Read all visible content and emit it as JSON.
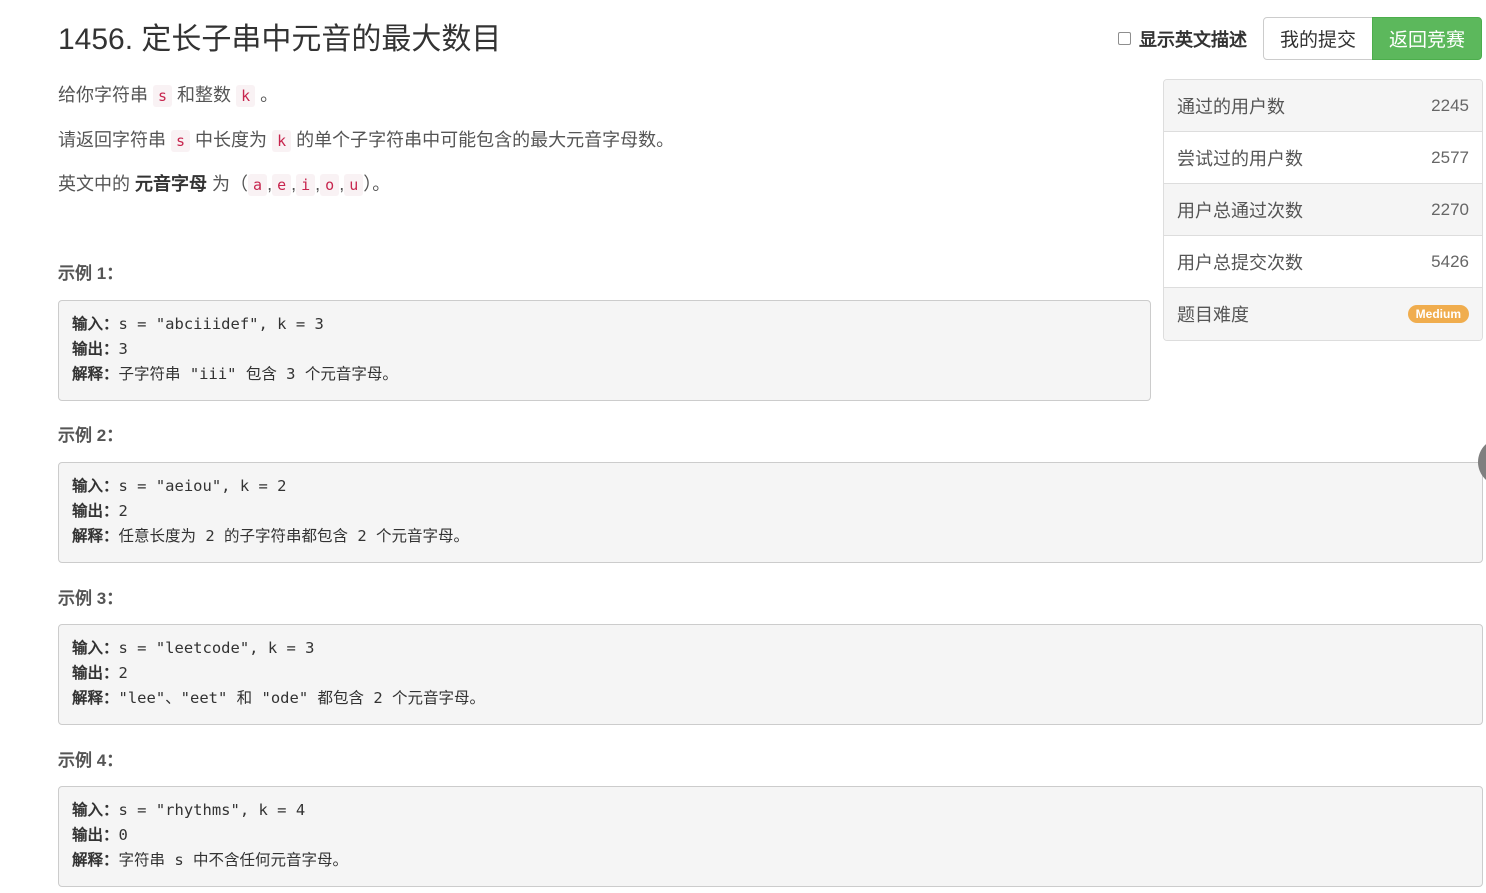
{
  "problem": {
    "title": "1456. 定长子串中元音的最大数目"
  },
  "controls": {
    "show_english_label": "显示英文描述",
    "my_submissions_label": "我的提交",
    "back_to_contest_label": "返回竞赛"
  },
  "description": {
    "line1": {
      "prefix": "给你字符串 ",
      "code1": "s",
      "mid": " 和整数 ",
      "code2": "k",
      "suffix": " 。"
    },
    "line2": {
      "prefix": "请返回字符串 ",
      "code1": "s",
      "mid": " 中长度为 ",
      "code2": "k",
      "suffix": " 的单个子字符串中可能包含的最大元音字母数。"
    },
    "line3": {
      "prefix": "英文中的 ",
      "bold": "元音字母",
      "mid": " 为（",
      "v1": "a",
      "v2": "e",
      "v3": "i",
      "v4": "o",
      "v5": "u",
      "sep": ",",
      "suffix": "）。"
    }
  },
  "examples": [
    {
      "title": "示例 1：",
      "in_label": "输入：",
      "input": "s = \"abciiidef\", k = 3",
      "out_label": "输出：",
      "output": "3",
      "exp_label": "解释：",
      "explanation": "子字符串 \"iii\" 包含 3 个元音字母。"
    },
    {
      "title": "示例 2：",
      "in_label": "输入：",
      "input": "s = \"aeiou\", k = 2",
      "out_label": "输出：",
      "output": "2",
      "exp_label": "解释：",
      "explanation": "任意长度为 2 的子字符串都包含 2 个元音字母。"
    },
    {
      "title": "示例 3：",
      "in_label": "输入：",
      "input": "s = \"leetcode\", k = 3",
      "out_label": "输出：",
      "output": "2",
      "exp_label": "解释：",
      "explanation": "\"lee\"、\"eet\" 和 \"ode\" 都包含 2 个元音字母。"
    },
    {
      "title": "示例 4：",
      "in_label": "输入：",
      "input": "s = \"rhythms\", k = 4",
      "out_label": "输出：",
      "output": "0",
      "exp_label": "解释：",
      "explanation": "字符串 s 中不含任何元音字母。"
    }
  ],
  "stats": [
    {
      "label": "通过的用户数",
      "value": "2245"
    },
    {
      "label": "尝试过的用户数",
      "value": "2577"
    },
    {
      "label": "用户总通过次数",
      "value": "2270"
    },
    {
      "label": "用户总提交次数",
      "value": "5426"
    },
    {
      "label": "题目难度",
      "value": "Medium"
    }
  ],
  "colors": {
    "accent_green": "#5cb85c",
    "difficulty_medium": "#f0ad4e",
    "code_red": "#c7254e"
  }
}
